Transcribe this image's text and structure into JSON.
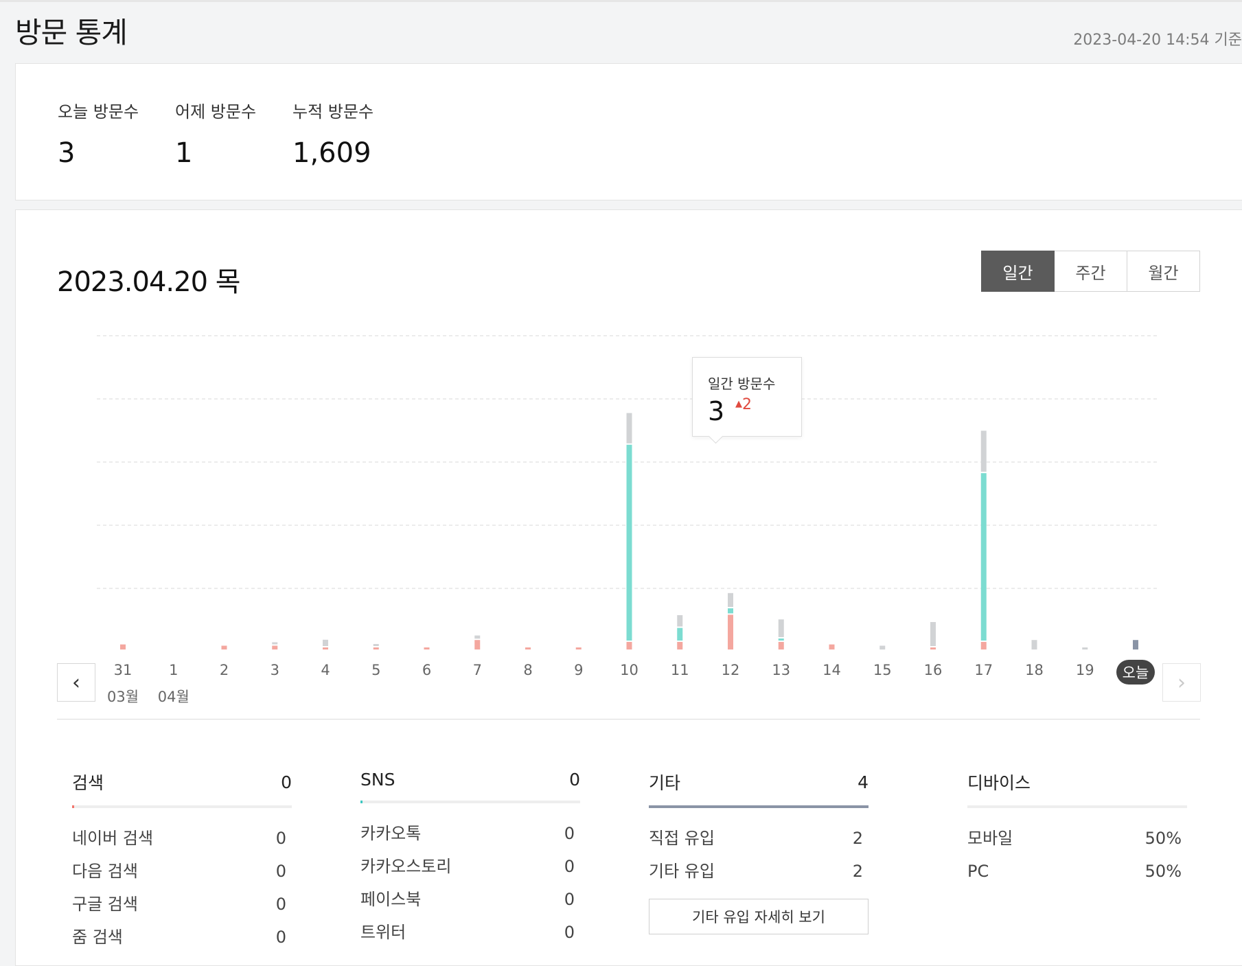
{
  "header": {
    "title": "방문 통계",
    "as_of": "2023-04-20 14:54 기준"
  },
  "summary": [
    {
      "label": "오늘 방문수",
      "value": "3"
    },
    {
      "label": "어제 방문수",
      "value": "1"
    },
    {
      "label": "누적 방문수",
      "value": "1,609"
    }
  ],
  "main": {
    "date_heading": "2023.04.20 목",
    "tabs": [
      "일간",
      "주간",
      "월간"
    ],
    "active_tab": "일간",
    "prev_icon": "chevron-left-icon",
    "next_icon": "chevron-right-icon"
  },
  "tooltip": {
    "label": "일간 방문수",
    "value": "3",
    "change": "2"
  },
  "colors": {
    "search": "#f2766d",
    "sns": "#3dc7c1",
    "direct": "#7cdcd1",
    "other": "#f4a79f",
    "unknown": "#d1d3d5",
    "today": "#8a94a6"
  },
  "chart_data": {
    "type": "bar",
    "stacked": true,
    "categories": [
      "31",
      "1",
      "2",
      "3",
      "4",
      "5",
      "6",
      "7",
      "8",
      "9",
      "10",
      "11",
      "12",
      "13",
      "14",
      "15",
      "16",
      "17",
      "18",
      "19",
      "오늘"
    ],
    "month_labels": [
      {
        "index": 0,
        "label": "03월"
      },
      {
        "index": 1,
        "label": "04월"
      }
    ],
    "series": [
      {
        "color": "#f4a79f",
        "values": [
          0.08,
          0,
          0.06,
          0.06,
          0.02,
          0.02,
          0.01,
          0.15,
          0.01,
          0.01,
          0.12,
          0.12,
          0.55,
          0.12,
          0.08,
          0,
          0.02,
          0.12,
          0,
          0,
          0
        ]
      },
      {
        "color": "#7cdcd1",
        "values": [
          0,
          0,
          0,
          0,
          0,
          0,
          0,
          0,
          0,
          0,
          3.1,
          0.2,
          0.08,
          0.02,
          0,
          0,
          0,
          2.65,
          0,
          0,
          0
        ]
      },
      {
        "color": "#d1d3d5",
        "values": [
          0,
          0,
          0,
          0.03,
          0.1,
          0.02,
          0,
          0.05,
          0,
          0,
          0.48,
          0.18,
          0.22,
          0.28,
          0,
          0.06,
          0.38,
          0.65,
          0.15,
          0.02,
          0.15
        ]
      }
    ],
    "ylim": [
      0,
      5
    ],
    "grid": true,
    "legend": false
  },
  "panels": [
    {
      "title": "검색",
      "total": "0",
      "bar_color": "#f2766d",
      "bar_fraction": 0.01,
      "rows": [
        {
          "label": "네이버 검색",
          "value": "0"
        },
        {
          "label": "다음 검색",
          "value": "0"
        },
        {
          "label": "구글 검색",
          "value": "0"
        },
        {
          "label": "줌 검색",
          "value": "0"
        }
      ]
    },
    {
      "title": "SNS",
      "total": "0",
      "bar_color": "#3dc7c1",
      "bar_fraction": 0.01,
      "rows": [
        {
          "label": "카카오톡",
          "value": "0"
        },
        {
          "label": "카카오스토리",
          "value": "0"
        },
        {
          "label": "페이스북",
          "value": "0"
        },
        {
          "label": "트위터",
          "value": "0"
        }
      ]
    },
    {
      "title": "기타",
      "total": "4",
      "bar_color": "#8a94a6",
      "bar_fraction": 1.0,
      "rows": [
        {
          "label": "직접 유입",
          "value": "2"
        },
        {
          "label": "기타 유입",
          "value": "2"
        }
      ],
      "button": "기타 유입 자세히 보기"
    },
    {
      "title": "디바이스",
      "total": "",
      "bar_color": "#eeeeee",
      "bar_fraction": 0,
      "rows": [
        {
          "label": "모바일",
          "value": "50%"
        },
        {
          "label": "PC",
          "value": "50%"
        }
      ]
    }
  ]
}
